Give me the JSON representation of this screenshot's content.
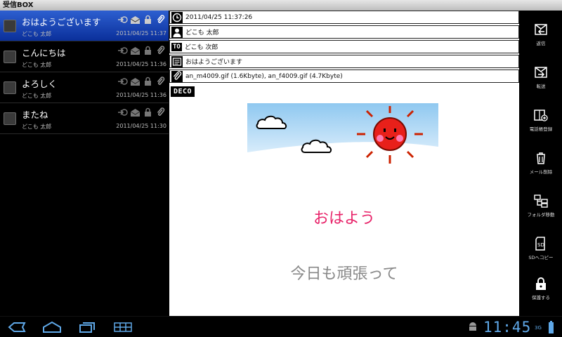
{
  "app": {
    "title": "受信BOX"
  },
  "list": {
    "items": [
      {
        "subject": "おはようございます",
        "sender": "どこも 太郎",
        "date": "2011/04/25 11:37",
        "selected": true
      },
      {
        "subject": "こんにちは",
        "sender": "どこも 太郎",
        "date": "2011/04/25 11:36",
        "selected": false
      },
      {
        "subject": "よろしく",
        "sender": "どこも 太郎",
        "date": "2011/04/25 11:36",
        "selected": false
      },
      {
        "subject": "またね",
        "sender": "どこも 太郎",
        "date": "2011/04/25 11:30",
        "selected": false
      }
    ]
  },
  "detail": {
    "date": "2011/04/25 11:37:26",
    "from": "どこも 太郎",
    "to_badge": "TO",
    "to": "どこも 次郎",
    "subject": "おはようございます",
    "attachments": "an_m4009.gif (1.6Kbyte), an_f4009.gif (4.7Kbyte)",
    "deco_badge": "DECO",
    "body_line1": "おはよう",
    "body_line2": "今日も頑張って",
    "colors": {
      "greeting": "#e8246a",
      "body_gray": "#888888"
    }
  },
  "actions": [
    {
      "label": "返信",
      "icon": "reply-mail-icon"
    },
    {
      "label": "転送",
      "icon": "forward-mail-icon"
    },
    {
      "label": "電話帳登録",
      "icon": "phonebook-add-icon"
    },
    {
      "label": "メール削除",
      "icon": "trash-icon"
    },
    {
      "label": "フォルダ移動",
      "icon": "folder-move-icon"
    },
    {
      "label": "SDへコピー",
      "icon": "sd-card-icon"
    },
    {
      "label": "保護する",
      "icon": "lock-icon"
    }
  ],
  "system_bar": {
    "clock": "11:45",
    "network": "3G",
    "colors": {
      "accent": "#5fa8e8"
    }
  },
  "colors": {
    "selected_row": "#1e4cc0",
    "background": "#000000"
  }
}
